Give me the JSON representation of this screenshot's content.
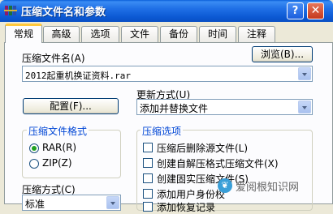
{
  "window": {
    "title": "压缩文件名和参数",
    "help_label": "?",
    "close_label": "✕",
    "icon": "winrar-books-icon"
  },
  "tabs": [
    {
      "label": "常规",
      "active": true
    },
    {
      "label": "高级"
    },
    {
      "label": "选项"
    },
    {
      "label": "文件"
    },
    {
      "label": "备份"
    },
    {
      "label": "时间"
    },
    {
      "label": "注释"
    }
  ],
  "archive_name": {
    "label": "压缩文件名(A)",
    "value": "2012起重机换证资料.rar",
    "browse_label": "浏览(B)..."
  },
  "update_mode": {
    "label": "更新方式(U)",
    "value": "添加并替换文件"
  },
  "profiles_label": "配置(F)...",
  "archive_format": {
    "title": "压缩文件格式",
    "options": [
      {
        "label": "RAR(R)",
        "checked": true
      },
      {
        "label": "ZIP(Z)",
        "checked": false
      }
    ]
  },
  "archive_options": {
    "title": "压缩选项",
    "items": [
      {
        "label": "压缩后删除源文件(L)"
      },
      {
        "label": "创建自解压格式压缩文件(X)"
      },
      {
        "label": "创建固实压缩文件(S)"
      },
      {
        "label": "添加用户身份校"
      },
      {
        "label": "添加恢复记录"
      }
    ]
  },
  "compression_method": {
    "label": "压缩方式(C)",
    "value": "标准"
  },
  "watermark": {
    "text": "爱阅根知识网",
    "icon": "leaf-icon"
  }
}
